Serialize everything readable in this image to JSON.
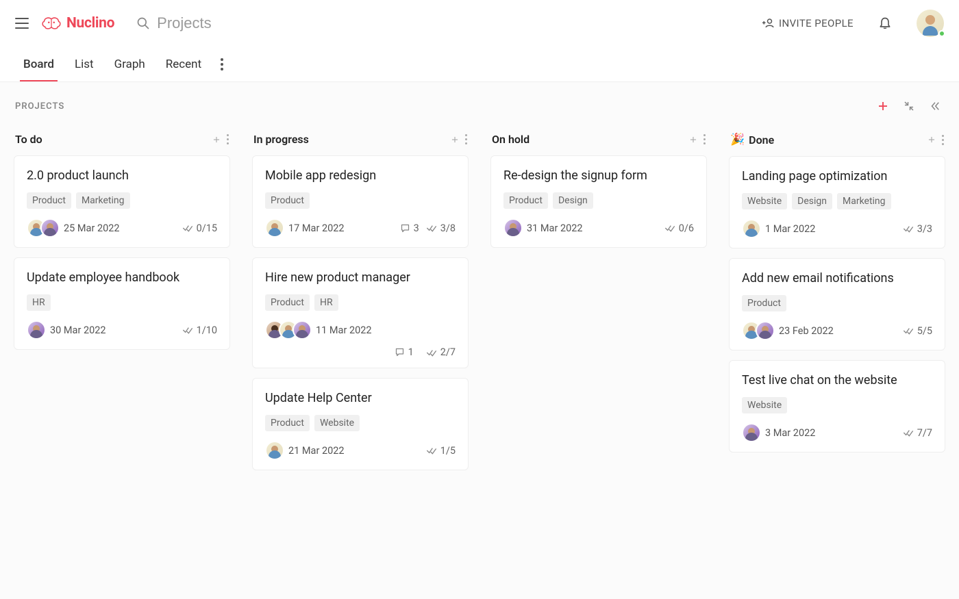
{
  "app": {
    "logo_text": "Nuclino",
    "search_placeholder": "Projects",
    "invite_label": "INVITE PEOPLE"
  },
  "tabs": {
    "items": [
      "Board",
      "List",
      "Graph",
      "Recent"
    ],
    "active": 0
  },
  "breadcrumb": "PROJECTS",
  "columns": [
    {
      "title": "To do",
      "emoji": "",
      "cards": [
        {
          "title": "2.0 product launch",
          "tags": [
            "Product",
            "Marketing"
          ],
          "avatars": [
            "c1",
            "c2"
          ],
          "date": "25 Mar 2022",
          "comments": null,
          "checks": "0/15"
        },
        {
          "title": "Update employee handbook",
          "tags": [
            "HR"
          ],
          "avatars": [
            "c2"
          ],
          "date": "30 Mar 2022",
          "comments": null,
          "checks": "1/10"
        }
      ]
    },
    {
      "title": "In progress",
      "emoji": "",
      "cards": [
        {
          "title": "Mobile app redesign",
          "tags": [
            "Product"
          ],
          "avatars": [
            "c1"
          ],
          "date": "17 Mar 2022",
          "comments": "3",
          "checks": "3/8"
        },
        {
          "title": "Hire new product manager",
          "tags": [
            "Product",
            "HR"
          ],
          "avatars": [
            "c3",
            "c1",
            "c2"
          ],
          "date": "11 Mar 2022",
          "comments": "1",
          "checks": "2/7",
          "wrap": true
        },
        {
          "title": "Update Help Center",
          "tags": [
            "Product",
            "Website"
          ],
          "avatars": [
            "c1"
          ],
          "date": "21 Mar 2022",
          "comments": null,
          "checks": "1/5"
        }
      ]
    },
    {
      "title": "On hold",
      "emoji": "",
      "cards": [
        {
          "title": "Re-design the signup form",
          "tags": [
            "Product",
            "Design"
          ],
          "avatars": [
            "c2"
          ],
          "date": "31 Mar 2022",
          "comments": null,
          "checks": "0/6"
        }
      ]
    },
    {
      "title": "Done",
      "emoji": "🎉",
      "cards": [
        {
          "title": "Landing page optimization",
          "tags": [
            "Website",
            "Design",
            "Marketing"
          ],
          "avatars": [
            "c1"
          ],
          "date": "1 Mar 2022",
          "comments": null,
          "checks": "3/3"
        },
        {
          "title": "Add new email notifications",
          "tags": [
            "Product"
          ],
          "avatars": [
            "c1",
            "c2"
          ],
          "date": "23 Feb 2022",
          "comments": null,
          "checks": "5/5"
        },
        {
          "title": "Test live chat on the website",
          "tags": [
            "Website"
          ],
          "avatars": [
            "c2"
          ],
          "date": "3 Mar 2022",
          "comments": null,
          "checks": "7/7"
        }
      ]
    }
  ]
}
